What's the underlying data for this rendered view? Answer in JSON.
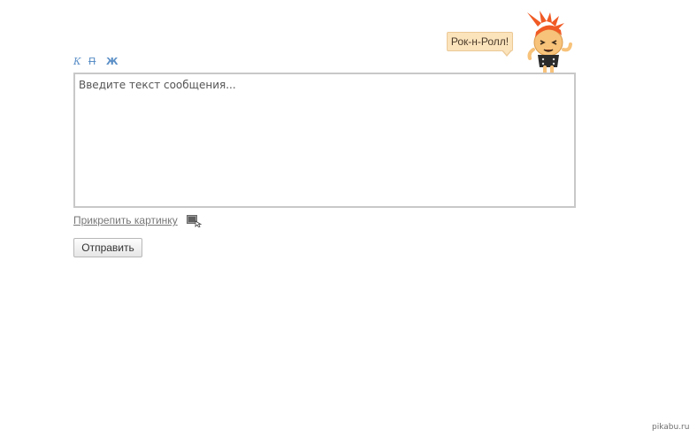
{
  "formatting": {
    "italic_label": "К",
    "strike_label": "П",
    "bold_label": "Ж"
  },
  "mascot": {
    "speech": "Рок-н-Ролл!",
    "icon": "rock-punk-mascot"
  },
  "message": {
    "placeholder": "Введите текст сообщения...",
    "value": ""
  },
  "attach": {
    "label": "Прикрепить картинку",
    "icon": "attach-image-icon"
  },
  "submit": {
    "label": "Отправить"
  },
  "watermark": "pikabu.ru",
  "colors": {
    "format_link": "#5b8fc7",
    "bubble_bg": "#fbe3bc",
    "mascot_hair": "#f05a24",
    "mascot_face": "#f7c27a"
  }
}
